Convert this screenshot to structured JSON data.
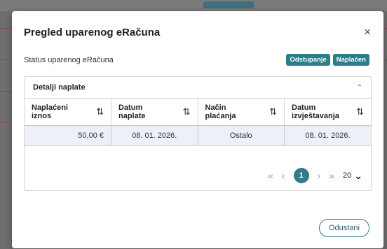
{
  "modal": {
    "title": "Pregled uparenog eRačuna",
    "close_glyph": "×",
    "status_label": "Status uparenog eRačuna",
    "badges": [
      "Odstupanje",
      "Naplaćen"
    ],
    "accent_color": "#2e7d8c"
  },
  "details": {
    "title": "Detalji naplate",
    "collapse_glyph": "⌃",
    "columns": [
      "Naplaćeni iznos",
      "Datum naplate",
      "Način plaćanja",
      "Datum izvještavanja"
    ],
    "sort_glyph": "⇅",
    "rows": [
      [
        "50,00 €",
        "08. 01. 2026.",
        "Ostalo",
        "08. 01. 2026."
      ]
    ]
  },
  "pagination": {
    "first_glyph": "«",
    "prev_glyph": "‹",
    "current_page": "1",
    "next_glyph": "›",
    "last_glyph": "»",
    "page_size": "20",
    "page_size_glyph": "⌄"
  },
  "footer": {
    "cancel_label": "Odustani"
  },
  "icons": {
    "close": "close-icon",
    "collapse": "chevron-up-icon",
    "sort": "sort-icon",
    "first": "double-chevron-left-icon",
    "prev": "chevron-left-icon",
    "next": "chevron-right-icon",
    "last": "double-chevron-right-icon",
    "dropdown": "chevron-down-icon"
  }
}
